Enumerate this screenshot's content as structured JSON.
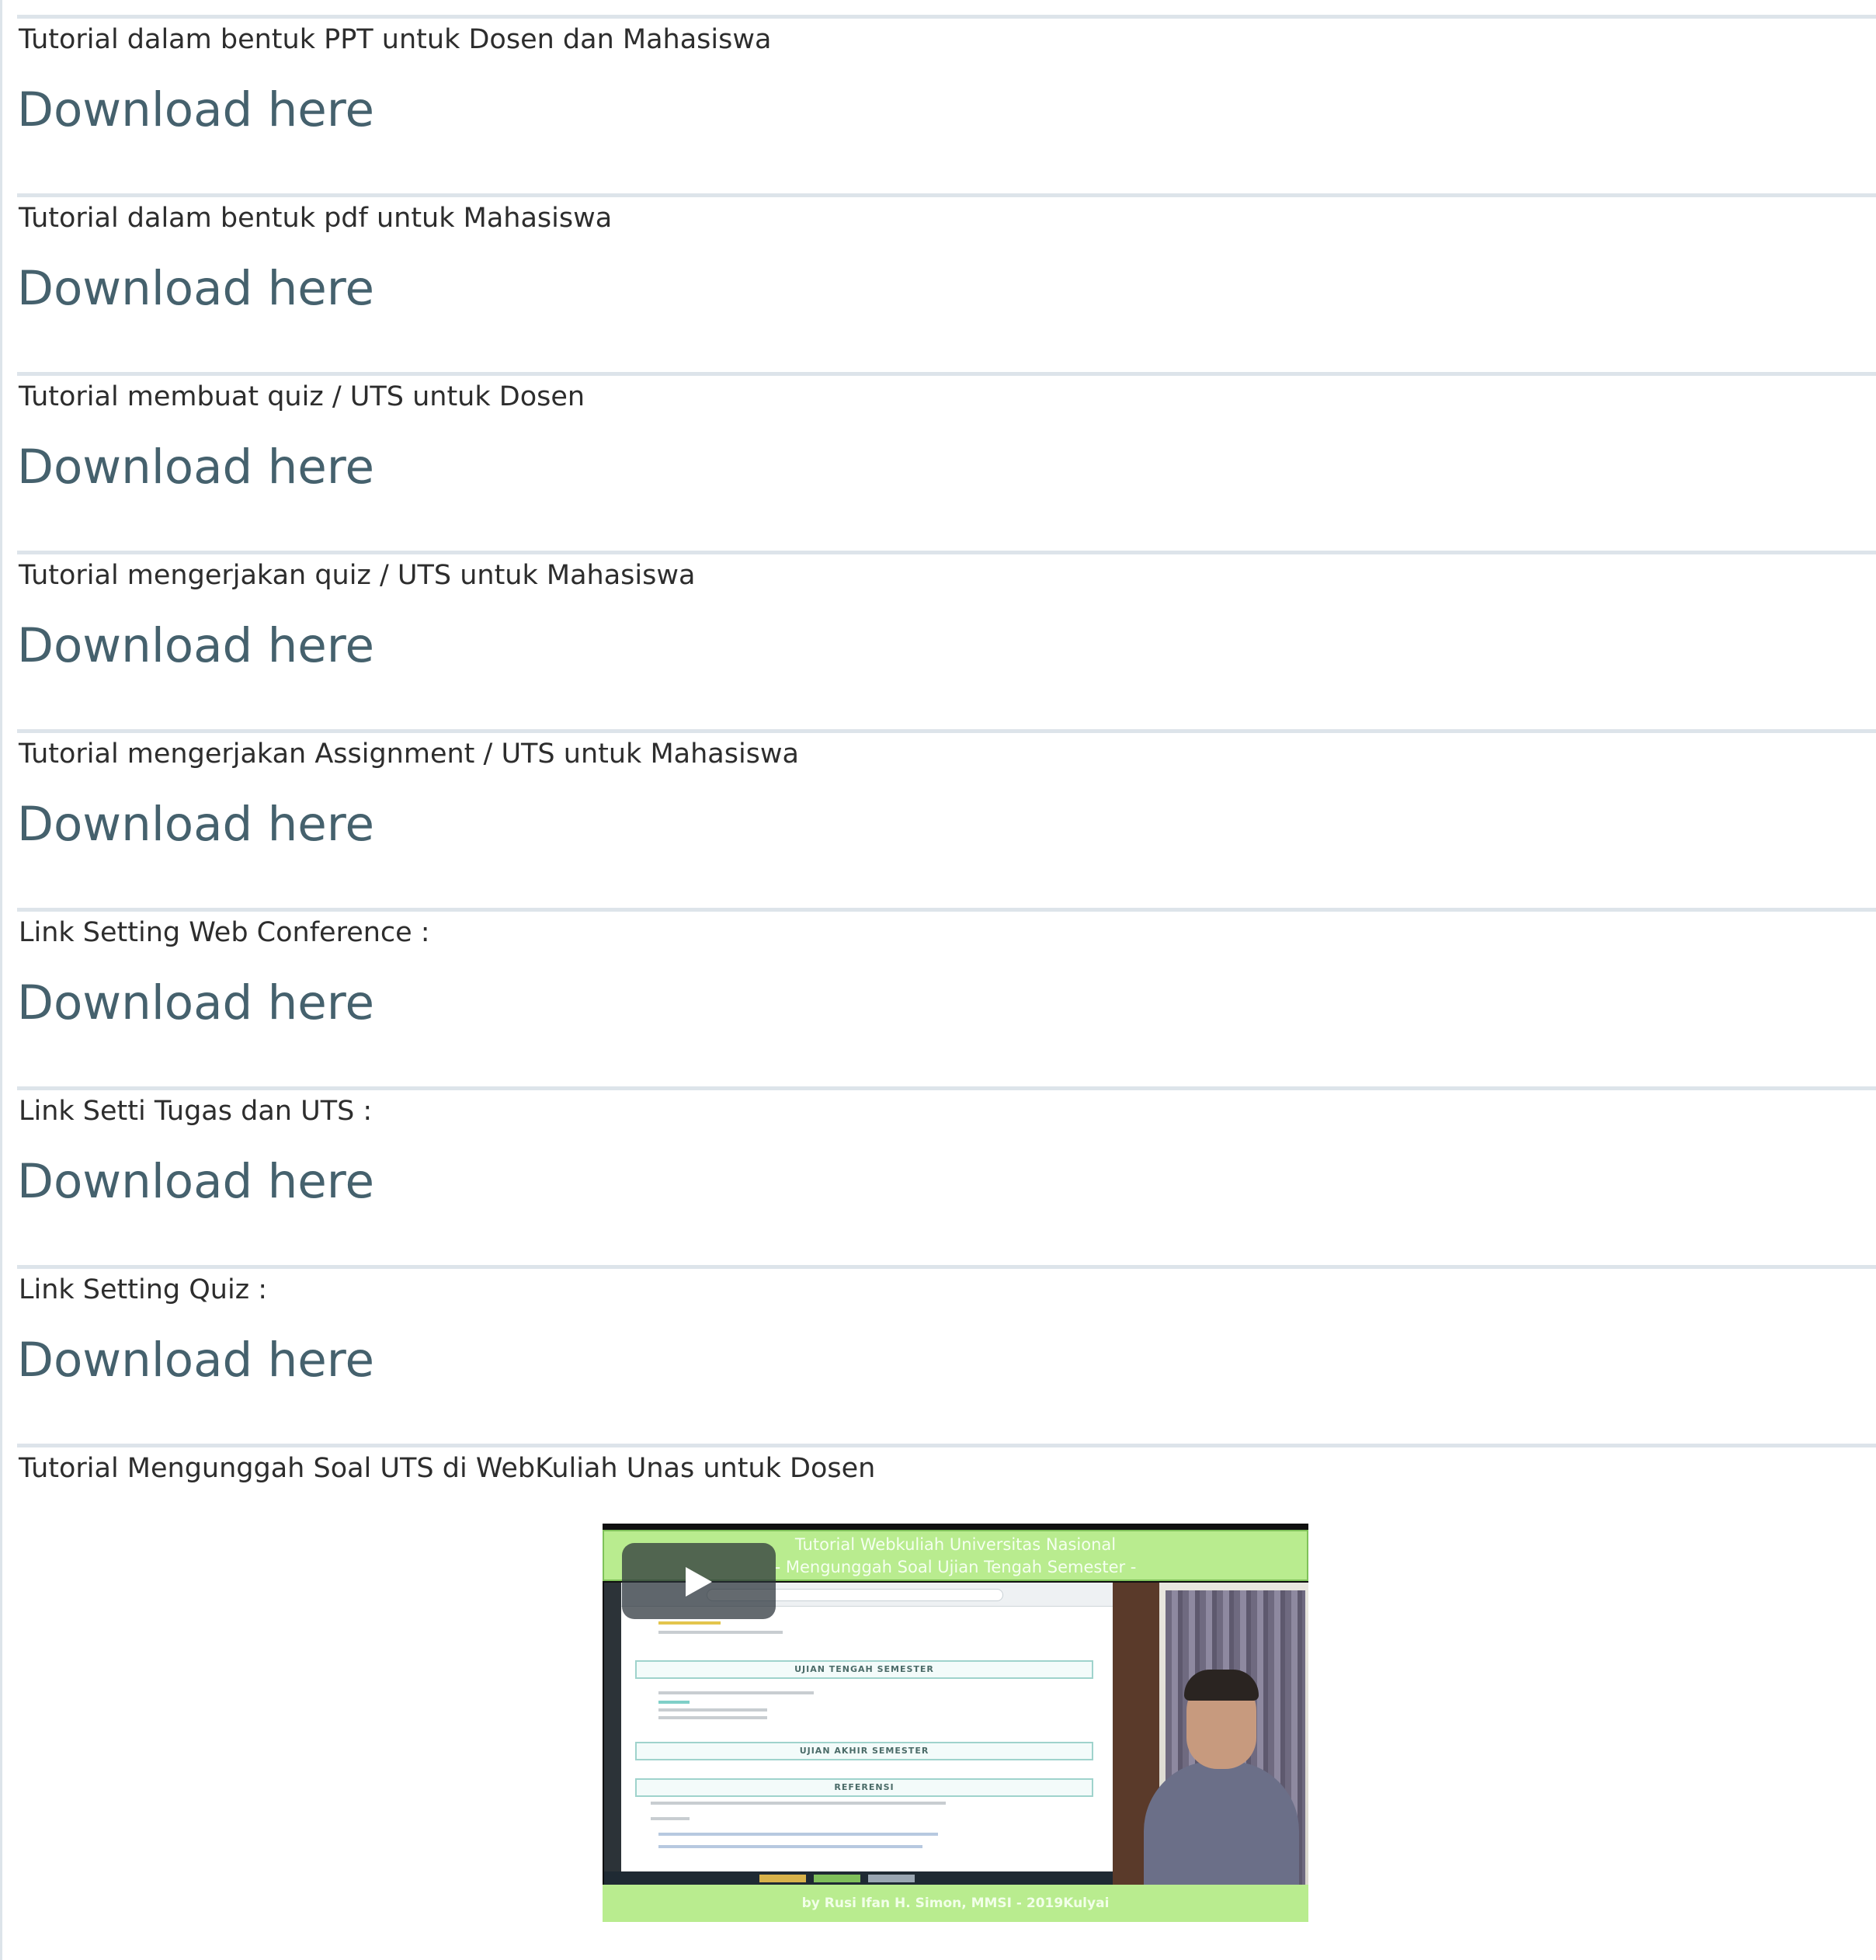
{
  "resources": [
    {
      "label": "Tutorial dalam bentuk PPT untuk Dosen dan Mahasiswa",
      "link": "Download here"
    },
    {
      "label": "Tutorial dalam bentuk pdf untuk Mahasiswa",
      "link": "Download here"
    },
    {
      "label": "Tutorial membuat quiz / UTS untuk Dosen",
      "link": "Download here"
    },
    {
      "label": "Tutorial mengerjakan quiz / UTS untuk Mahasiswa",
      "link": "Download here"
    },
    {
      "label": "Tutorial mengerjakan Assignment / UTS untuk Mahasiswa",
      "link": "Download here"
    },
    {
      "label": "Link Setting Web Conference :",
      "link": "Download here"
    },
    {
      "label": "Link Setti Tugas dan UTS :",
      "link": "Download here"
    },
    {
      "label": "Link Setting Quiz :",
      "link": "Download here"
    }
  ],
  "video_section": {
    "label": "Tutorial Mengunggah Soal UTS di WebKuliah Unas untuk Dosen",
    "video": {
      "banner_line1": "Tutorial Webkuliah Universitas Nasional",
      "banner_line2": "- Mengunggah Soal Ujian Tengah Semester -",
      "footer": "by Rusi Ifan H. Simon, MMSI - 2019Kulyai",
      "sections": [
        "UJIAN TENGAH SEMESTER",
        "UJIAN AKHIR SEMESTER",
        "REFERENSI"
      ],
      "play_icon": "play-icon"
    }
  },
  "colors": {
    "divider": "#dde4ea",
    "link": "#45616d",
    "label": "#2d2d2d",
    "video_banner": "#b9ec8f"
  }
}
